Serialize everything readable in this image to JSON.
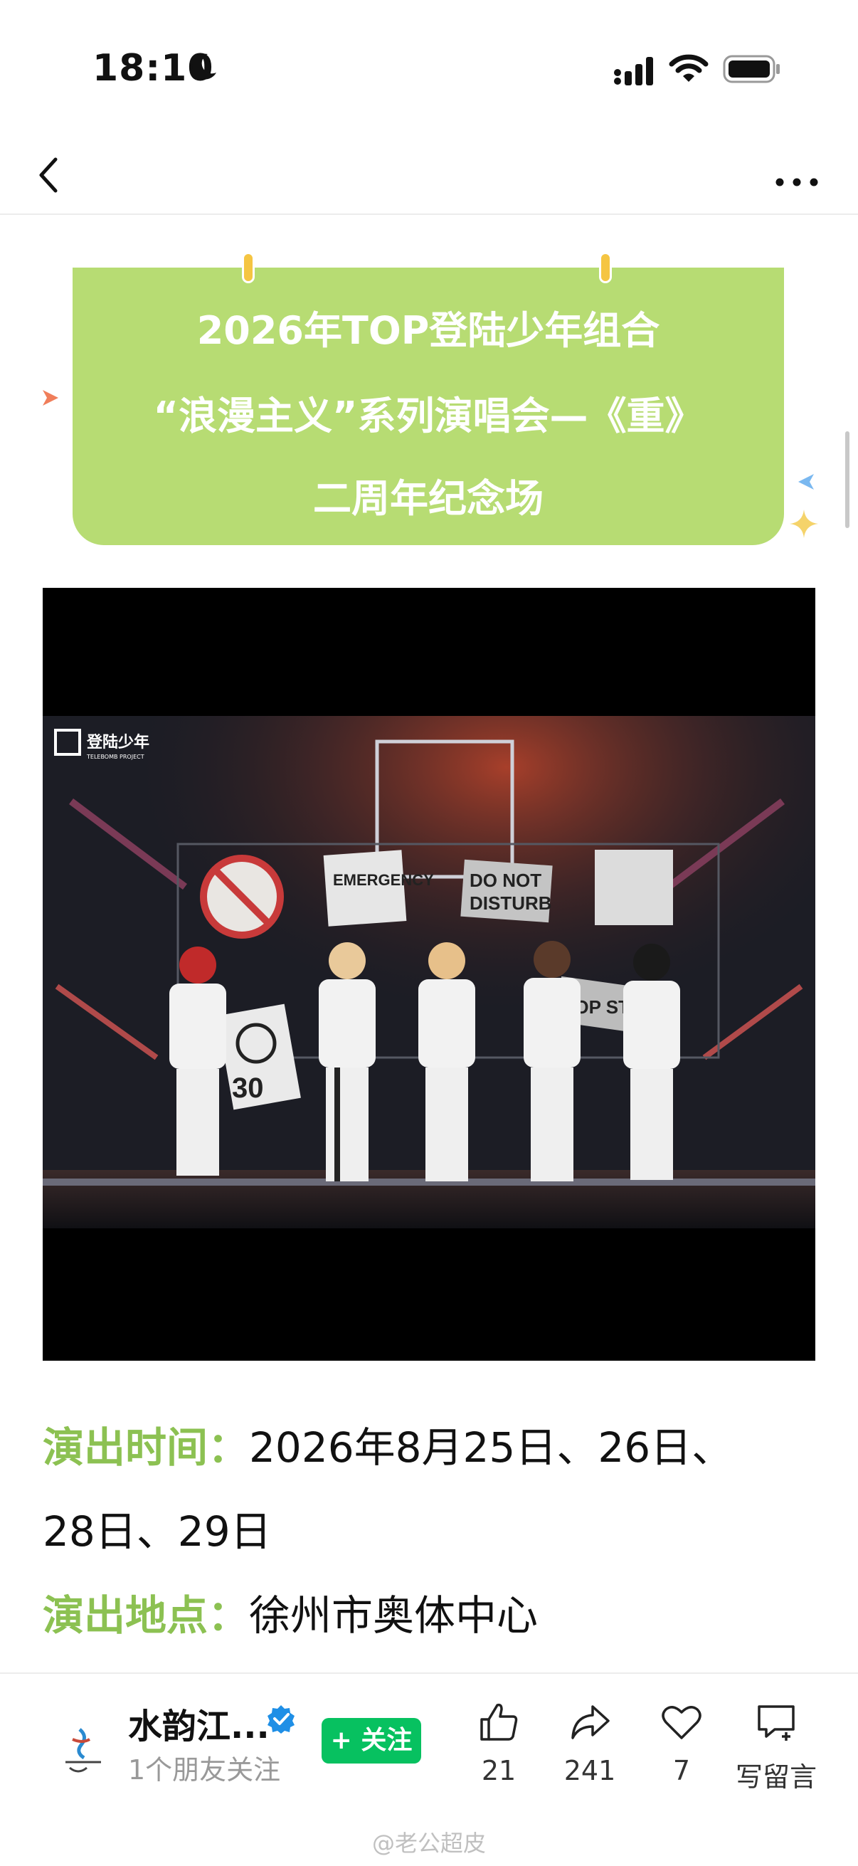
{
  "status_bar": {
    "time": "18:10",
    "icons": [
      "moon-icon",
      "signal-icon",
      "wifi-icon",
      "battery-icon"
    ]
  },
  "nav": {
    "back_icon": "chevron-left-icon",
    "more_icon": "ellipsis-icon"
  },
  "banner": {
    "line1": "2026年TOP登陆少年组合",
    "line2": "“浪漫主义”系列演唱会—《重》",
    "line3": "二周年纪念场",
    "bg_color": "#b7dc73"
  },
  "video": {
    "logo_text": "登陆少年",
    "logo_sub": "TELEBOMB PROJECT",
    "sign_do_not_disturb_1": "DO NOT",
    "sign_do_not_disturb_2": "DISTURB",
    "sign_emergency": "EMERGENCY",
    "sign_no_parking": "NO PARKING",
    "sign_number": "30",
    "sign_top": "TOP STREET"
  },
  "info": {
    "time_label": "演出时间：",
    "time_value": "2026年8月25日、26日、",
    "time_value_cont": "28日、29日",
    "place_label": "演出地点：",
    "place_value": "徐州市奥体中心",
    "label_color": "#8cc152"
  },
  "account": {
    "name": "水韵江...",
    "sub": "1个朋友关注",
    "follow_label": "+ 关注",
    "follow_color": "#07c160"
  },
  "actions": {
    "like_count": "21",
    "share_count": "241",
    "fav_count": "7",
    "comment_label": "写留言"
  },
  "watermark": "@老公超皮"
}
